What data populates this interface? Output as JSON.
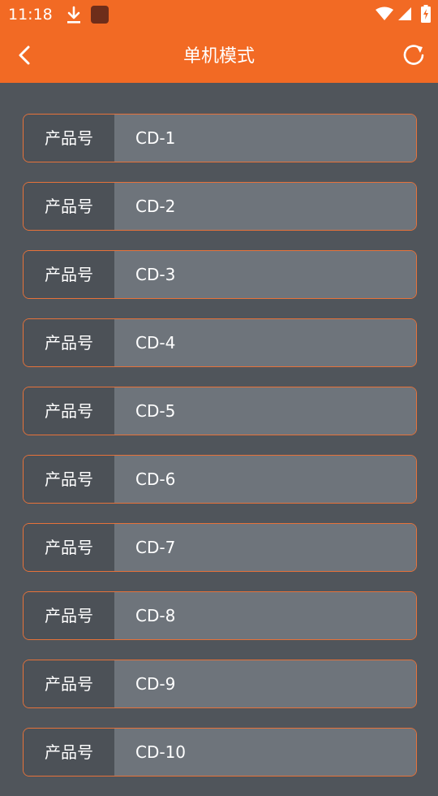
{
  "status_bar": {
    "time": "11:18",
    "icons": [
      "download-icon",
      "app-notification-icon",
      "wifi-icon",
      "cell-signal-icon",
      "battery-charging-icon"
    ]
  },
  "header": {
    "title": "单机模式",
    "back_icon": "chevron-left-icon",
    "refresh_icon": "refresh-icon",
    "background_color": "#f26a24"
  },
  "products": [
    {
      "label": "产品号",
      "value": "CD-1"
    },
    {
      "label": "产品号",
      "value": "CD-2"
    },
    {
      "label": "产品号",
      "value": "CD-3"
    },
    {
      "label": "产品号",
      "value": "CD-4"
    },
    {
      "label": "产品号",
      "value": "CD-5"
    },
    {
      "label": "产品号",
      "value": "CD-6"
    },
    {
      "label": "产品号",
      "value": "CD-7"
    },
    {
      "label": "产品号",
      "value": "CD-8"
    },
    {
      "label": "产品号",
      "value": "CD-9"
    },
    {
      "label": "产品号",
      "value": "CD-10"
    }
  ],
  "colors": {
    "page_background": "#50555b",
    "row_border": "#e6723a",
    "label_background": "#4c5157",
    "value_background": "#6e747b"
  }
}
